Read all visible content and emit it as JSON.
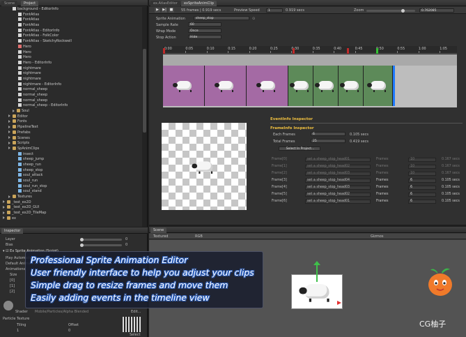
{
  "project": {
    "tabs": [
      "Scene",
      "Project"
    ],
    "tree": [
      {
        "label": "background - EditorInfo",
        "icon": "file",
        "indent": 18
      },
      {
        "label": "FontAtlas",
        "icon": "file",
        "indent": 26
      },
      {
        "label": "FontAtlas",
        "icon": "file",
        "indent": 26
      },
      {
        "label": "FontAtlas",
        "icon": "file",
        "indent": 26
      },
      {
        "label": "FontAtlas - EditorInfo",
        "icon": "file",
        "indent": 26
      },
      {
        "label": "FontAtlas - FolkColor",
        "icon": "file",
        "indent": 26
      },
      {
        "label": "FontAtlas - SketchyRockwell",
        "icon": "file",
        "indent": 26
      },
      {
        "label": "Hero",
        "icon": "sprite",
        "indent": 26
      },
      {
        "label": "Hero",
        "icon": "file",
        "indent": 26
      },
      {
        "label": "Hero",
        "icon": "file",
        "indent": 26
      },
      {
        "label": "Hero - EditorInfo",
        "icon": "file",
        "indent": 26
      },
      {
        "label": "nightmare",
        "icon": "file",
        "indent": 26
      },
      {
        "label": "nightmare",
        "icon": "file",
        "indent": 26
      },
      {
        "label": "nightmare",
        "icon": "file",
        "indent": 26
      },
      {
        "label": "nightmare - EditorInfo",
        "icon": "file",
        "indent": 26
      },
      {
        "label": "normal_sheep",
        "icon": "file",
        "indent": 26
      },
      {
        "label": "normal_sheep",
        "icon": "file",
        "indent": 26
      },
      {
        "label": "normal_sheep",
        "icon": "file",
        "indent": 26
      },
      {
        "label": "normal_sheep - EditorInfo",
        "icon": "file",
        "indent": 26
      },
      {
        "label": "Soul",
        "icon": "folder",
        "indent": 18
      },
      {
        "label": "Editor",
        "icon": "folder",
        "indent": 12
      },
      {
        "label": "Fonts",
        "icon": "folder",
        "indent": 12
      },
      {
        "label": "PipelineText",
        "icon": "folder",
        "indent": 12
      },
      {
        "label": "Prefabs",
        "icon": "folder",
        "indent": 12
      },
      {
        "label": "Scenes",
        "icon": "folder",
        "indent": 12
      },
      {
        "label": "Scripts",
        "icon": "folder",
        "indent": 12
      },
      {
        "label": "SpAnimClips",
        "icon": "folder",
        "indent": 12
      },
      {
        "label": "insect",
        "icon": "anim",
        "indent": 26
      },
      {
        "label": "sheep_jump",
        "icon": "anim",
        "indent": 26
      },
      {
        "label": "sheep_run",
        "icon": "anim",
        "indent": 26
      },
      {
        "label": "sheep_stop",
        "icon": "anim",
        "indent": 26
      },
      {
        "label": "soul_attack",
        "icon": "anim",
        "indent": 26
      },
      {
        "label": "soul_run",
        "icon": "anim",
        "indent": 26
      },
      {
        "label": "soul_run_stop",
        "icon": "anim",
        "indent": 26
      },
      {
        "label": "soul_stand",
        "icon": "anim",
        "indent": 26
      },
      {
        "label": "Textures",
        "icon": "folder",
        "indent": 12
      },
      {
        "label": "_test_ex2D",
        "icon": "folder",
        "indent": 4
      },
      {
        "label": "_test_ex2D_GUI",
        "icon": "folder",
        "indent": 4
      },
      {
        "label": "_test_ex2D_TileMap",
        "icon": "folder",
        "indent": 4
      },
      {
        "label": "ex",
        "icon": "folder",
        "indent": 4
      }
    ]
  },
  "inspector": {
    "tab": "Inspector",
    "layer_label": "Layer",
    "layer_value": "0",
    "bias_label": "Bias",
    "bias_value": "0",
    "component_title": "Ex Sprite Animation (Script)",
    "play_auto_label": "Play Automatically",
    "default_anim_label": "Default Animation",
    "animations_label": "Animations",
    "size_label": "Size",
    "elements": [
      "[0]",
      "[1]",
      "[2]"
    ],
    "shader_label": "Shader",
    "shader_value": "Mobile/Particles/Alpha Blended",
    "edit_label": "Edit...",
    "texture_label": "Particle Texture",
    "tiling_label": "Tiling",
    "offset_label": "Offset",
    "tiling_x": "1",
    "offset_x": "0",
    "select_label": "Select"
  },
  "anim": {
    "tabs": [
      "ex.AtlasEditor",
      "exSpriteAnimClip"
    ],
    "frames_info": "55 frames | 0.919 secs",
    "preview_speed_label": "Preview Speed",
    "preview_speed_value": "1",
    "preview_time": "0.919 secs",
    "zoom_label": "Zoom",
    "zoom_value": "0.762085",
    "sprite_anim_label": "Sprite Animation",
    "sprite_anim_value": "sheep_stop",
    "sample_rate_label": "Sample Rate",
    "sample_rate_value": "60",
    "wrap_mode_label": "Wrap Mode",
    "wrap_mode_value": "Once",
    "stop_action_label": "Stop Action",
    "stop_action_value": "Hide",
    "ticks": [
      "0:00",
      "0:05",
      "0:10",
      "0:15",
      "0:20",
      "0:25",
      "0:30",
      "0:35",
      "0:40",
      "0:45",
      "0:50",
      "0:55",
      "1:00",
      "1:05"
    ],
    "events": [
      {
        "label": "Frame[0]",
        "name": "set a sheep_stop_head01",
        "time": "0.167 secs",
        "frames": "10"
      },
      {
        "label": "Frame[1]",
        "name": "set a sheep_stop_head02",
        "time": "0.167 secs",
        "frames": "10"
      },
      {
        "label": "Frame[2]",
        "name": "set a sheep_stop_head03",
        "time": "0.167 secs",
        "frames": "10"
      },
      {
        "label": "Frame[3]",
        "name": "set a sheep_stop_head04",
        "time": "0.105 secs",
        "frames": "6"
      },
      {
        "label": "Frame[4]",
        "name": "set a sheep_stop_head03",
        "time": "0.105 secs",
        "frames": "6"
      },
      {
        "label": "Frame[5]",
        "name": "set a sheep_stop_head02",
        "time": "0.105 secs",
        "frames": "6"
      },
      {
        "label": "Frame[6]",
        "name": "set a sheep_stop_head01",
        "time": "0.105 secs",
        "frames": "6"
      }
    ],
    "event_info_title": "EventInfo Inspector",
    "frame_info_title": "FrameInfo Inspector",
    "each_frames_label": "Each Frames",
    "each_frames_value": "6",
    "each_frames_time": "0.105 secs",
    "total_frames_label": "Total Frames",
    "total_frames_value": "25",
    "total_frames_time": "0.419 secs",
    "select_button": "Select In Project...",
    "frames_word": "Frames"
  },
  "scene": {
    "tab": "Scene",
    "render_mode": "Textured",
    "color_mode": "RGB",
    "gizmos": "Gizmos"
  },
  "promo": {
    "line1": "Professional Sprite Animation Editor",
    "line2": "User friendly interface to help you adjust your clips",
    "line3": "Simple drag to resize frames and move them",
    "line4": "Easily adding events in the timeline view"
  },
  "watermark": "CG柚子",
  "colors": {
    "purple_frames": "#a46aa4",
    "green_frames": "#5d8a59",
    "playhead": "#1f7bff",
    "event_red": "#c02a2a",
    "event_green": "#34c234",
    "title_yellow": "#f0c040"
  }
}
